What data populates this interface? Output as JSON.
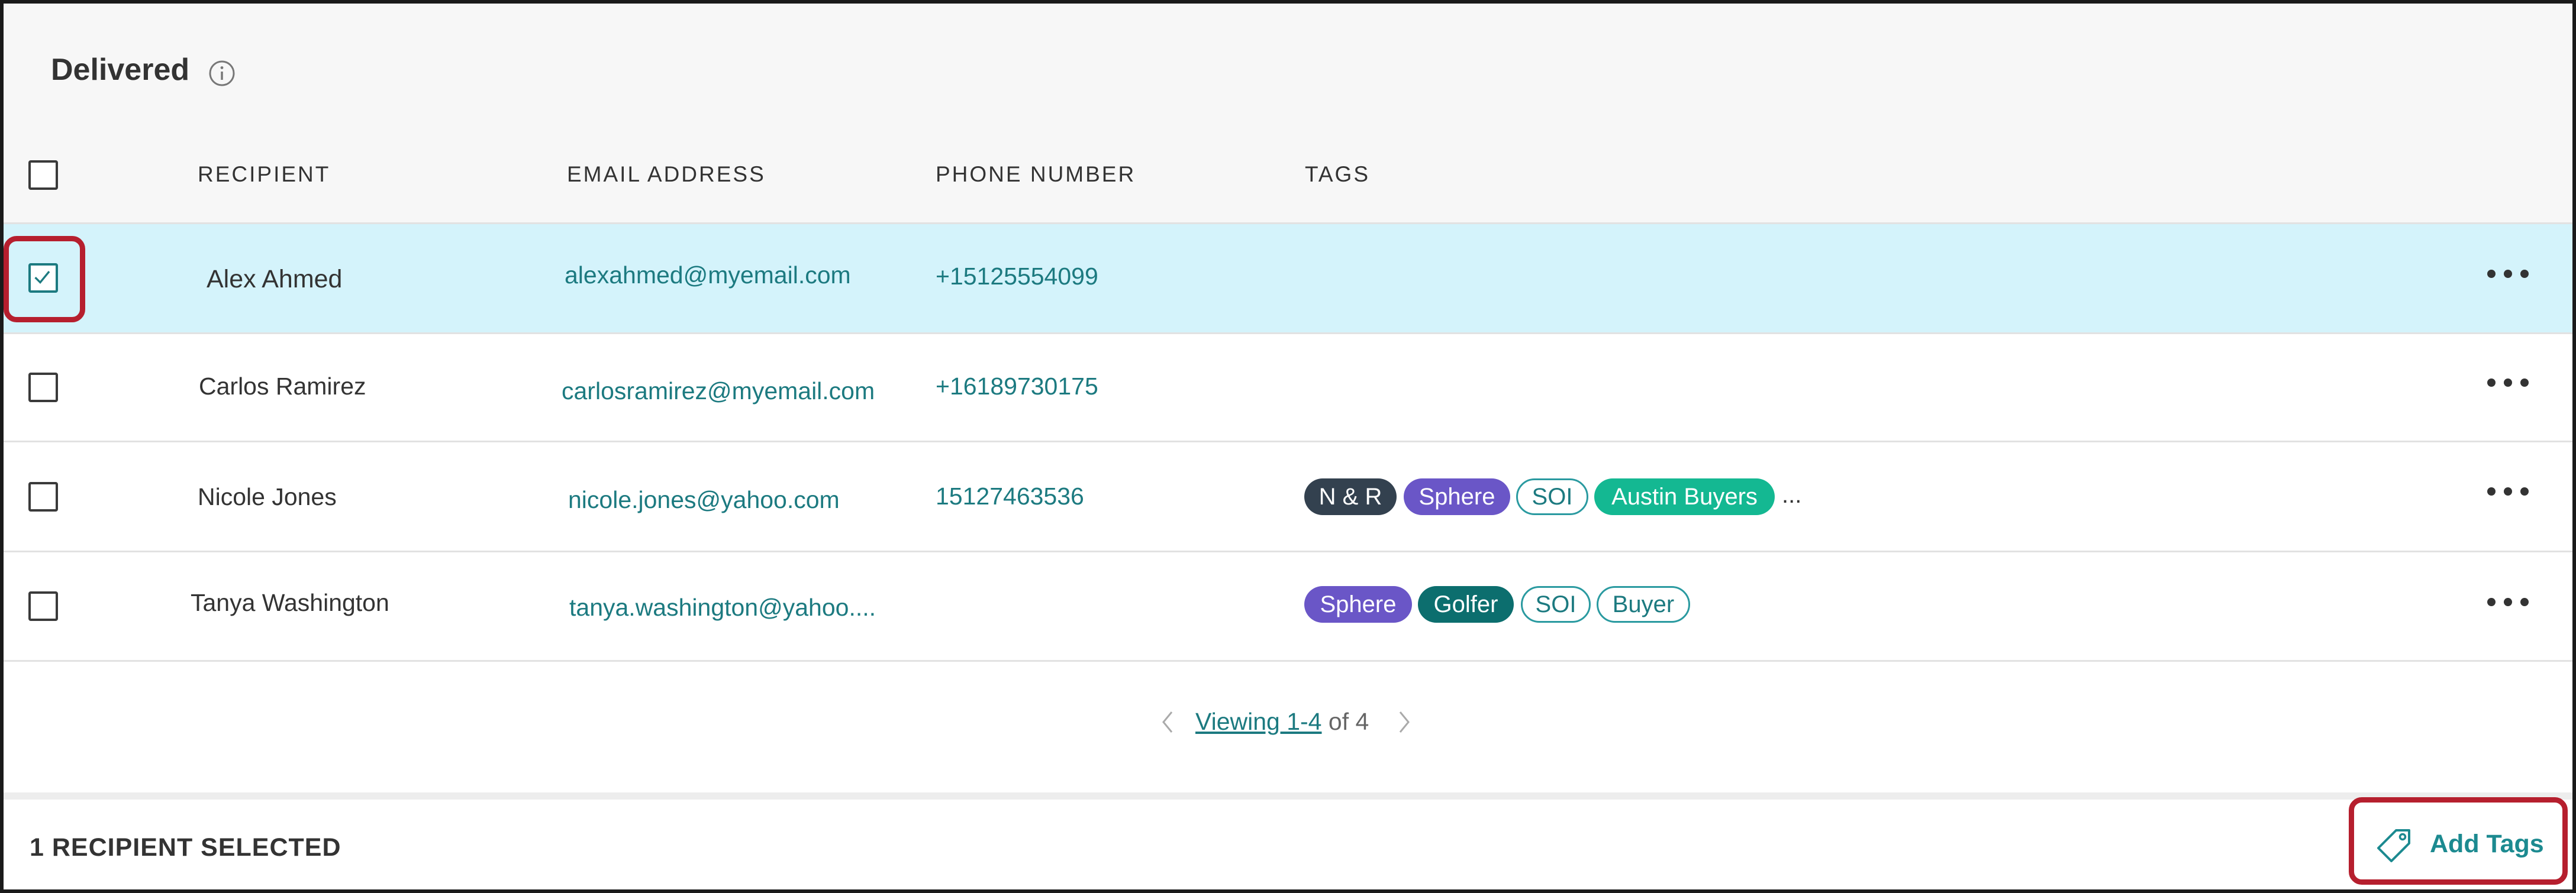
{
  "section": {
    "title": "Delivered"
  },
  "table": {
    "columns": [
      "RECIPIENT",
      "EMAIL ADDRESS",
      "PHONE NUMBER",
      "TAGS"
    ],
    "rows": [
      {
        "name": "Alex Ahmed",
        "email": "alexahmed@myemail.com",
        "phone": "+15125554099",
        "tags": [],
        "selected": true
      },
      {
        "name": "Carlos Ramirez",
        "email": "carlosramirez@myemail.com",
        "phone": "+16189730175",
        "tags": [],
        "selected": false
      },
      {
        "name": "Nicole Jones",
        "email": "nicole.jones@yahoo.com",
        "phone": "15127463536",
        "tags": [
          "N & R",
          "Sphere",
          "SOI",
          "Austin Buyers"
        ],
        "tags_overflow": "...",
        "selected": false
      },
      {
        "name": "Tanya Washington",
        "email": "tanya.washington@yahoo....",
        "phone": "",
        "tags": [
          "Sphere",
          "Golfer",
          "SOI",
          "Buyer"
        ],
        "selected": false
      }
    ]
  },
  "pagination": {
    "viewing": "Viewing 1-4",
    "of": "of 4"
  },
  "footer": {
    "selected_count": "1 RECIPIENT SELECTED",
    "add_tags_label": "Add Tags"
  },
  "colors": {
    "accent": "#1c7a80",
    "highlight": "#b61f2e",
    "selected_row": "#d4f3fb"
  },
  "icons": [
    "info-icon",
    "checkbox-checked-icon",
    "more-icon",
    "tag-icon",
    "chevron-left-icon",
    "chevron-right-icon"
  ]
}
